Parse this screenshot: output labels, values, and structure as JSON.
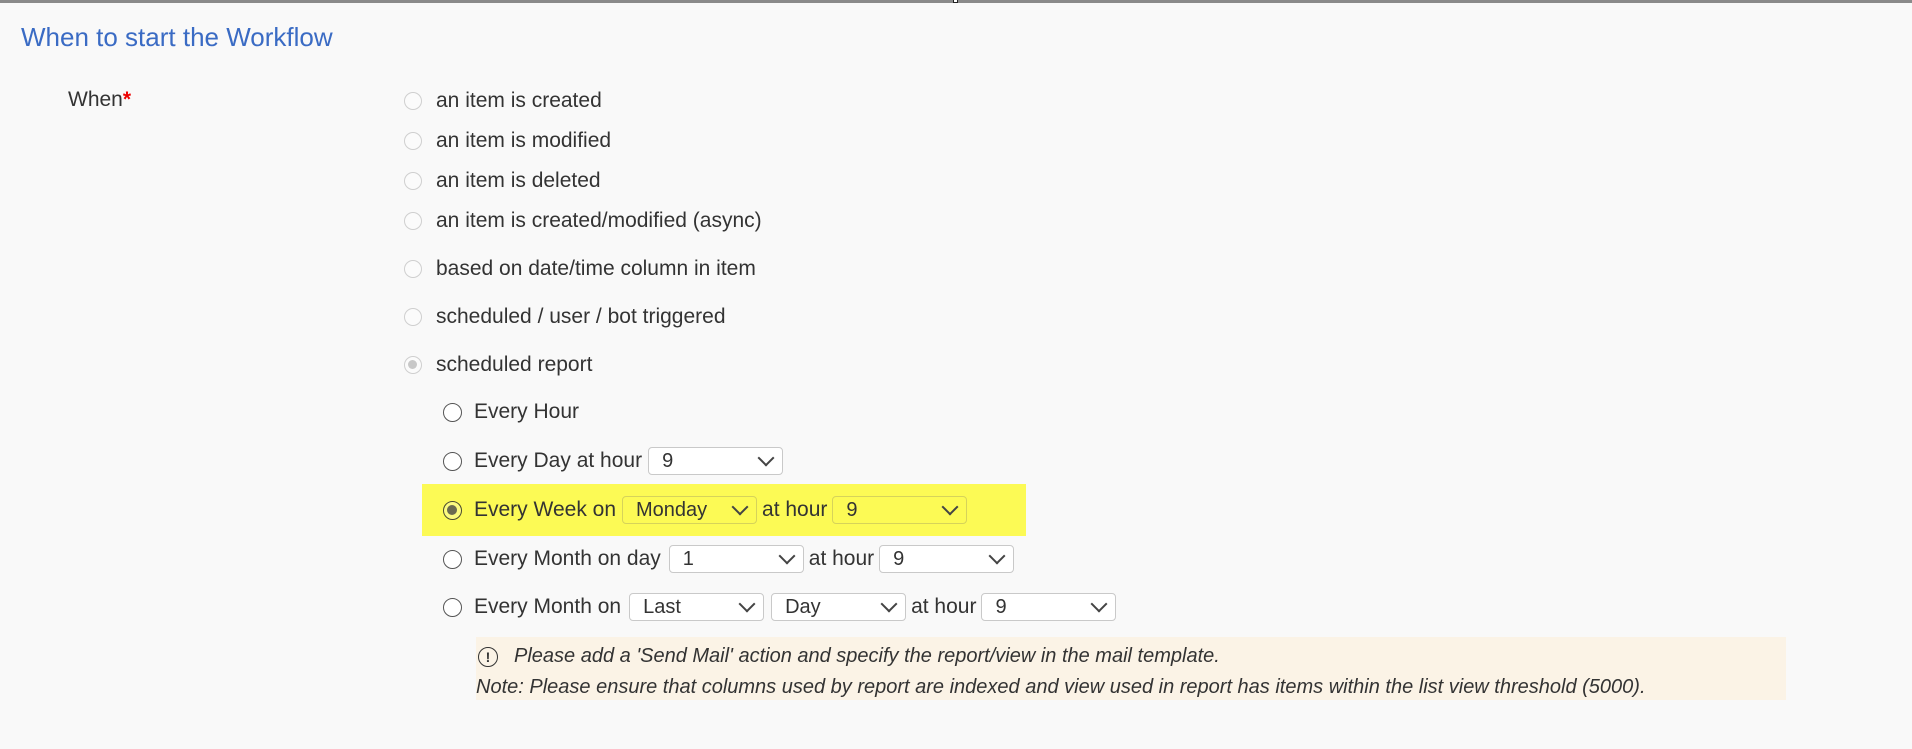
{
  "section": {
    "title": "When to start the Workflow"
  },
  "field": {
    "label": "When",
    "required_marker": "*"
  },
  "trigger_options": [
    {
      "label": "an item is created",
      "checked": false
    },
    {
      "label": "an item is modified",
      "checked": false
    },
    {
      "label": "an item is deleted",
      "checked": false
    },
    {
      "label": "an item is created/modified (async)",
      "checked": false
    },
    {
      "label": "based on date/time column in item",
      "checked": false
    },
    {
      "label": "scheduled / user / bot triggered",
      "checked": false
    },
    {
      "label": "scheduled report",
      "checked": true
    }
  ],
  "schedule": {
    "every_hour": {
      "label": "Every Hour"
    },
    "every_day": {
      "label": "Every Day at hour",
      "hour": "9"
    },
    "every_week": {
      "label": "Every Week on",
      "day": "Monday",
      "at_hour_label": "at hour",
      "hour": "9",
      "selected": true
    },
    "every_month_day": {
      "label": "Every Month on day",
      "day": "1",
      "at_hour_label": "at hour",
      "hour": "9"
    },
    "every_month_on": {
      "label": "Every Month on",
      "ordinal": "Last",
      "weekday": "Day",
      "at_hour_label": "at hour",
      "hour": "9"
    }
  },
  "note": {
    "icon": "exclamation-circle-icon",
    "line1": "Please add a 'Send Mail' action and specify the report/view in the mail template.",
    "line2": "Note: Please ensure that columns used by report are indexed and view used in report has items within the list view threshold (5000)."
  },
  "colors": {
    "title": "#3a6bc4",
    "highlight": "#fcfa55",
    "note_bg": "#fbf3e6",
    "required": "#ee0000"
  }
}
